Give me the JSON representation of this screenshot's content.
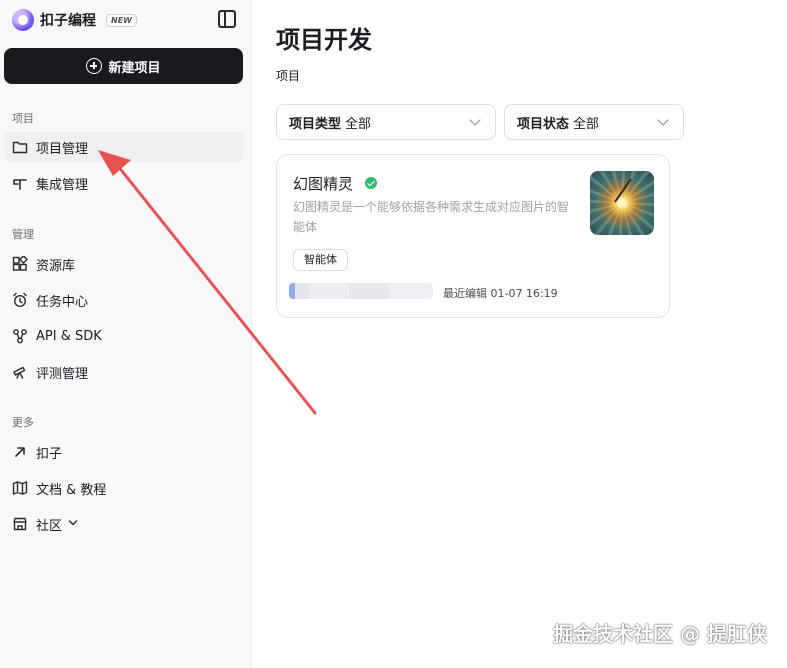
{
  "brand": {
    "name": "扣子编程",
    "badge": "NEW"
  },
  "sidebar": {
    "new_project_label": "新建项目",
    "sections": [
      {
        "label": "项目"
      },
      {
        "label": "管理"
      },
      {
        "label": "更多"
      }
    ],
    "items": [
      {
        "label": "项目管理",
        "icon": "folder-icon",
        "active": true
      },
      {
        "label": "集成管理",
        "icon": "integration-icon"
      },
      {
        "label": "资源库",
        "icon": "library-icon"
      },
      {
        "label": "任务中心",
        "icon": "alarm-clock-icon"
      },
      {
        "label": "API & SDK",
        "icon": "api-icon"
      },
      {
        "label": "评测管理",
        "icon": "telescope-icon"
      },
      {
        "label": "扣子",
        "icon": "arrow-up-right-icon"
      },
      {
        "label": "文档 & 教程",
        "icon": "map-icon"
      },
      {
        "label": "社区",
        "icon": "store-icon"
      }
    ]
  },
  "main": {
    "title": "项目开发",
    "subtitle": "项目",
    "filters": [
      {
        "label": "项目类型",
        "value": "全部"
      },
      {
        "label": "项目状态",
        "value": "全部"
      }
    ],
    "card": {
      "title": "幻图精灵",
      "description": "幻图精灵是一个能够依据各种需求生成对应图片的智能体",
      "tag": "智能体",
      "meta": "最近编辑 01-07 16:19"
    }
  },
  "watermark": "掘金技术社区 @ 提肛侠",
  "colors": {
    "accent": "#1a1a1e",
    "annotation_arrow": "#e8534f",
    "verified": "#2dbd6e"
  }
}
